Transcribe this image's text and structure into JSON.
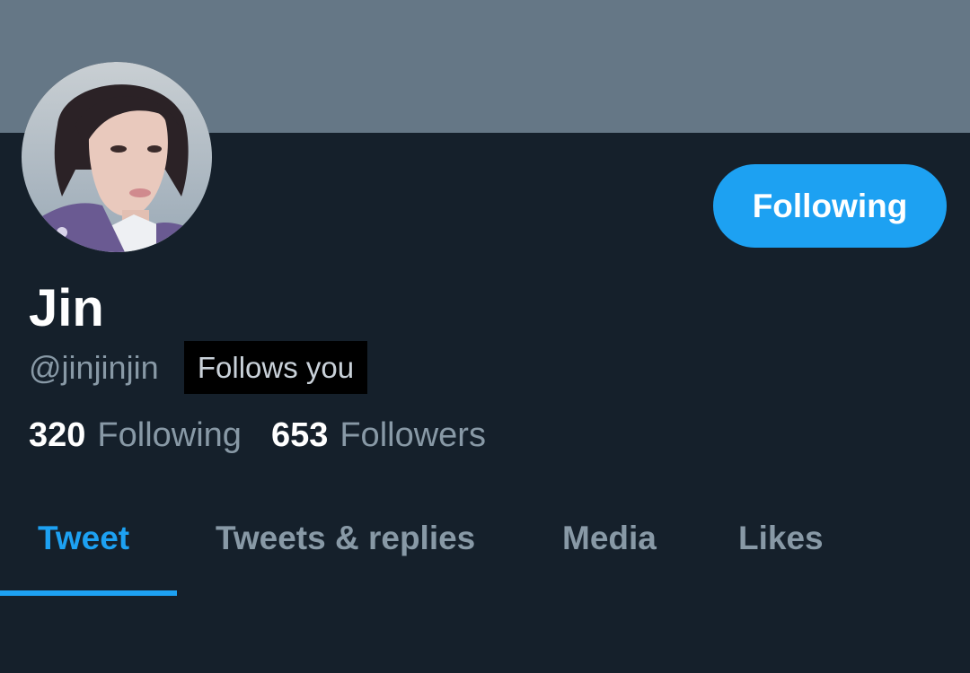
{
  "profile": {
    "display_name": "Jin",
    "handle": "@jinjinjin",
    "follows_you_badge": "Follows you",
    "follow_button_label": "Following"
  },
  "stats": {
    "following_count": "320",
    "following_label": "Following",
    "followers_count": "653",
    "followers_label": "Followers"
  },
  "tabs": [
    {
      "label": "Tweet",
      "active": true
    },
    {
      "label": "Tweets & replies",
      "active": false
    },
    {
      "label": "Media",
      "active": false
    },
    {
      "label": "Likes",
      "active": false
    }
  ],
  "colors": {
    "background": "#15202b",
    "banner": "#657786",
    "accent": "#1da1f2",
    "secondary_text": "#8899a6",
    "primary_text": "#ffffff"
  }
}
